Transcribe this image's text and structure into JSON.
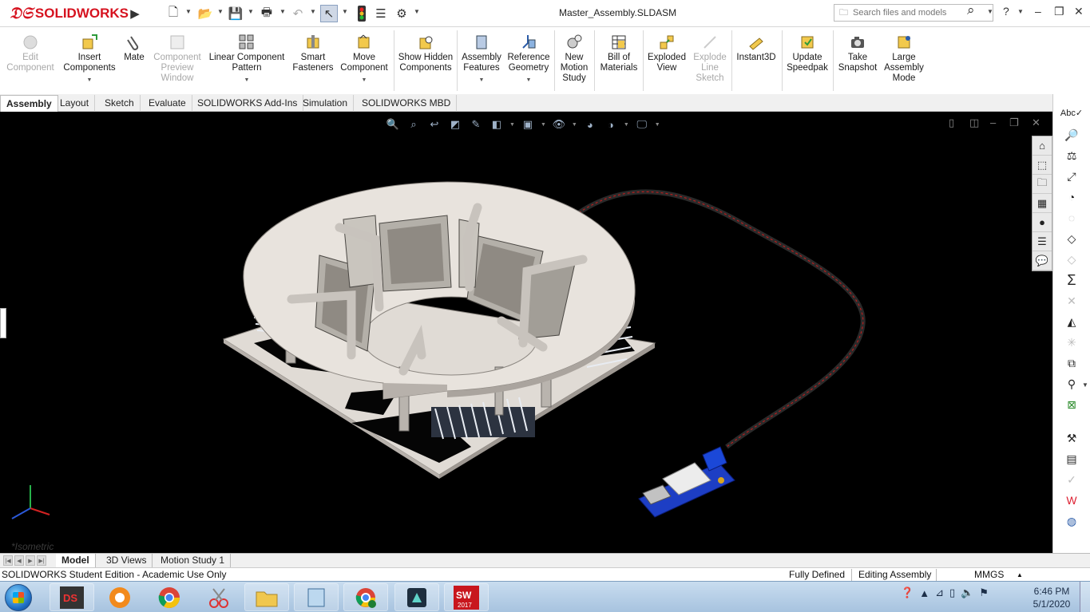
{
  "app": {
    "logo_text": "SOLIDWORKS",
    "document_title": "Master_Assembly.SLDASM",
    "search_placeholder": "Search files and models"
  },
  "commands": [
    {
      "id": "edit-component",
      "label": "Edit Component",
      "enabled": false
    },
    {
      "id": "insert-components",
      "label": "Insert Components",
      "enabled": true
    },
    {
      "id": "mate",
      "label": "Mate",
      "enabled": true
    },
    {
      "id": "component-preview-window",
      "label": "Component Preview Window",
      "enabled": false
    },
    {
      "id": "linear-component-pattern",
      "label": "Linear Component Pattern",
      "enabled": true
    },
    {
      "id": "smart-fasteners",
      "label": "Smart Fasteners",
      "enabled": true
    },
    {
      "id": "move-component",
      "label": "Move Component",
      "enabled": true
    },
    {
      "id": "show-hidden-components",
      "label": "Show Hidden Components",
      "enabled": true
    },
    {
      "id": "assembly-features",
      "label": "Assembly Features",
      "enabled": true
    },
    {
      "id": "reference-geometry",
      "label": "Reference Geometry",
      "enabled": true
    },
    {
      "id": "new-motion-study",
      "label": "New Motion Study",
      "enabled": true
    },
    {
      "id": "bill-of-materials",
      "label": "Bill of Materials",
      "enabled": true
    },
    {
      "id": "exploded-view",
      "label": "Exploded View",
      "enabled": true
    },
    {
      "id": "explode-line-sketch",
      "label": "Explode Line Sketch",
      "enabled": false
    },
    {
      "id": "instant3d",
      "label": "Instant3D",
      "enabled": true
    },
    {
      "id": "update-speedpak",
      "label": "Update Speedpak",
      "enabled": true
    },
    {
      "id": "take-snapshot",
      "label": "Take Snapshot",
      "enabled": true
    },
    {
      "id": "large-assembly-mode",
      "label": "Large Assembly Mode",
      "enabled": true
    }
  ],
  "tabs": [
    "Assembly",
    "Layout",
    "Sketch",
    "Evaluate",
    "SOLIDWORKS Add-Ins",
    "Simulation",
    "SOLIDWORKS MBD"
  ],
  "active_tab": "Assembly",
  "viewport": {
    "view_label": "*Isometric"
  },
  "bottom_tabs": [
    "Model",
    "3D Views",
    "Motion Study 1"
  ],
  "status": {
    "edition": "SOLIDWORKS Student Edition - Academic Use Only",
    "definition": "Fully Defined",
    "mode": "Editing Assembly",
    "units": "MMGS"
  },
  "clock": {
    "time": "6:46 PM",
    "date": "5/1/2020"
  },
  "colors": {
    "brand_red": "#d6121f",
    "viewport_bg": "#000000",
    "model_plate": "#e5e0da",
    "board_blue": "#1d3ec4"
  }
}
